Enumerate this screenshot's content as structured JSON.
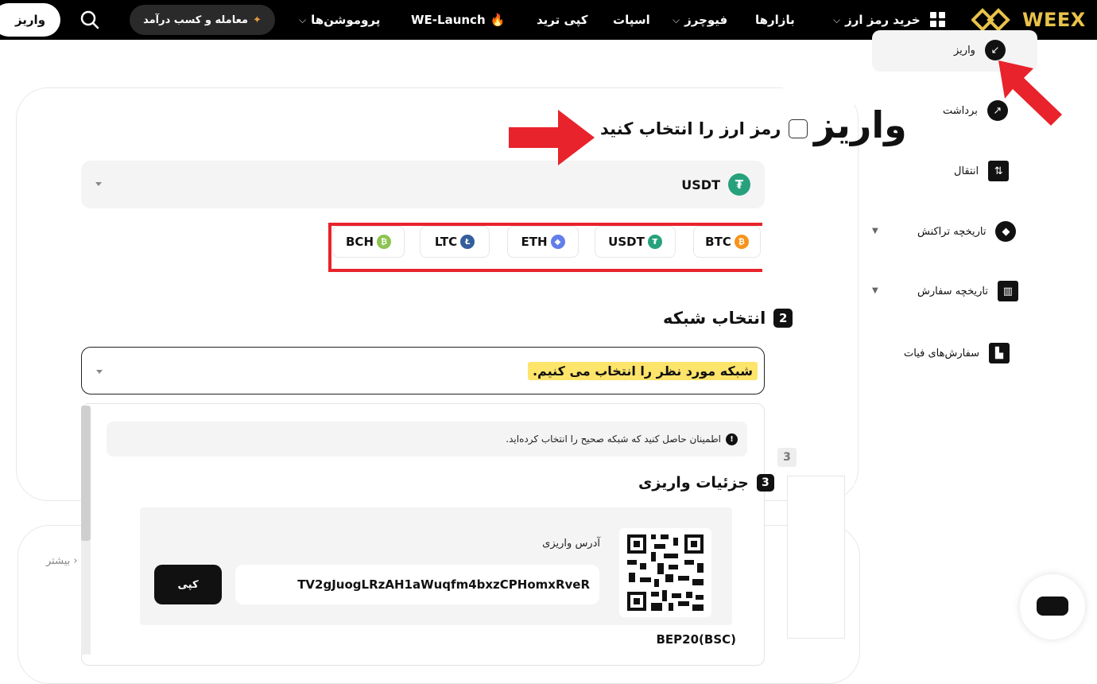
{
  "nav": {
    "brand": "WEEX",
    "items": [
      {
        "label": "خرید رمز ارز",
        "dropdown": true
      },
      {
        "label": "بازارها",
        "dropdown": false
      },
      {
        "label": "فیوچرز",
        "dropdown": true
      },
      {
        "label": "اسپات",
        "dropdown": false
      },
      {
        "label": "کپی ترید",
        "dropdown": false
      },
      {
        "label": "WE-Launch",
        "dropdown": false
      },
      {
        "label": "پروموشن‌ها",
        "dropdown": true
      }
    ],
    "earn_label": "معامله و کسب درآمد",
    "deposit_label": "واریز"
  },
  "sidebar": {
    "items": [
      {
        "label": "واریز",
        "icon": "arrow-down-left-icon",
        "active": true
      },
      {
        "label": "برداشت",
        "icon": "arrow-up-right-icon"
      },
      {
        "label": "انتقال",
        "icon": "transfer-icon"
      },
      {
        "label": "تاریخچه تراکنش",
        "icon": "history-icon",
        "expandable": true
      },
      {
        "label": "تاریخچه سفارش",
        "icon": "order-history-icon",
        "expandable": true
      },
      {
        "label": "سفارش‌های فیات",
        "icon": "fiat-orders-icon"
      }
    ]
  },
  "annotations": {
    "big_title": "واریز"
  },
  "step1": {
    "title": "رمز ارز را انتخاب کنید",
    "selected": "USDT",
    "quick_coins": [
      "BTC",
      "USDT",
      "ETH",
      "LTC",
      "BCH"
    ],
    "coin_colors": {
      "BTC": "#f7931a",
      "USDT": "#26a17b",
      "ETH": "#627eea",
      "LTC": "#345d9d",
      "BCH": "#8dc351"
    }
  },
  "step2": {
    "number": "2",
    "title": "انتخاب شبکه",
    "highlight": "شبکه مورد نظر را انتخاب می کنیم."
  },
  "dropdown": {
    "warning": "اطمینان حاصل کنید که شبکه صحیح را انتخاب کرده‌اید.",
    "step_number": "3",
    "title": "جزئیات واریزی",
    "address_label": "آدرس واریزی",
    "address": "TV2gJuogLRzAH1aWuqfm4bxzCPHomxRveR",
    "copy_label": "کپی",
    "network_name": "BEP20(BSC)"
  },
  "behind": {
    "step3_badge": "3",
    "more_label": "بیشتر"
  },
  "colors": {
    "accent_red": "#e8232b",
    "brand_gold": "#e8c24a",
    "highlight_yellow": "#fde46a"
  }
}
